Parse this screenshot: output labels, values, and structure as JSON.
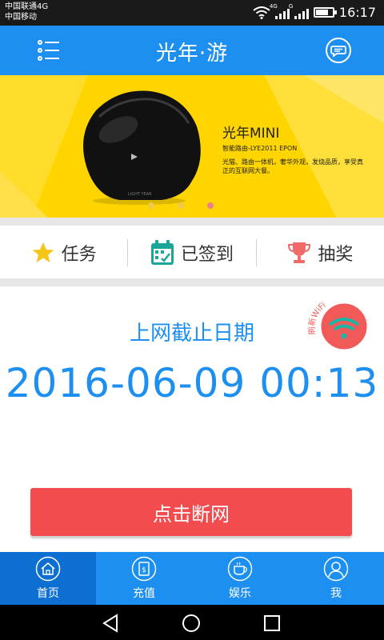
{
  "status_bar": {
    "carrier_1": "中国联通4G",
    "carrier_2": "中国移动",
    "net_type_1": "4G",
    "net_type_2": "G",
    "time": "16:17"
  },
  "header": {
    "title": "光年·游"
  },
  "banner": {
    "product_name": "光年MINI",
    "product_model": "智能路由-LYE2011   EPON",
    "product_desc": "光猫、路由一体机，奢华外观，发烧品质，享受真正的互联网大餐。",
    "device_label": "LIGHT YEAR",
    "slide_count": 3,
    "active_slide": 3
  },
  "actions": [
    {
      "label": "任务",
      "icon": "star-icon"
    },
    {
      "label": "已签到",
      "icon": "calendar-check-icon"
    },
    {
      "label": "抽奖",
      "icon": "trophy-icon"
    }
  ],
  "main": {
    "deadline_label": "上网截止日期",
    "deadline_value": "2016-06-09 00:13",
    "wifi_badge_label": "刷新WiFi",
    "disconnect_button": "点击断网"
  },
  "bottom_nav": [
    {
      "label": "首页",
      "icon": "home-icon",
      "active": true
    },
    {
      "label": "充值",
      "icon": "recharge-icon",
      "active": false
    },
    {
      "label": "娱乐",
      "icon": "coffee-icon",
      "active": false
    },
    {
      "label": "我",
      "icon": "user-icon",
      "active": false
    }
  ],
  "colors": {
    "primary": "#1c8ff0",
    "primary_dark": "#0d6fd1",
    "banner": "#ffd500",
    "danger": "#f24c4f",
    "star": "#f5c518",
    "calendar": "#1aa79a",
    "trophy": "#f06a6a"
  }
}
